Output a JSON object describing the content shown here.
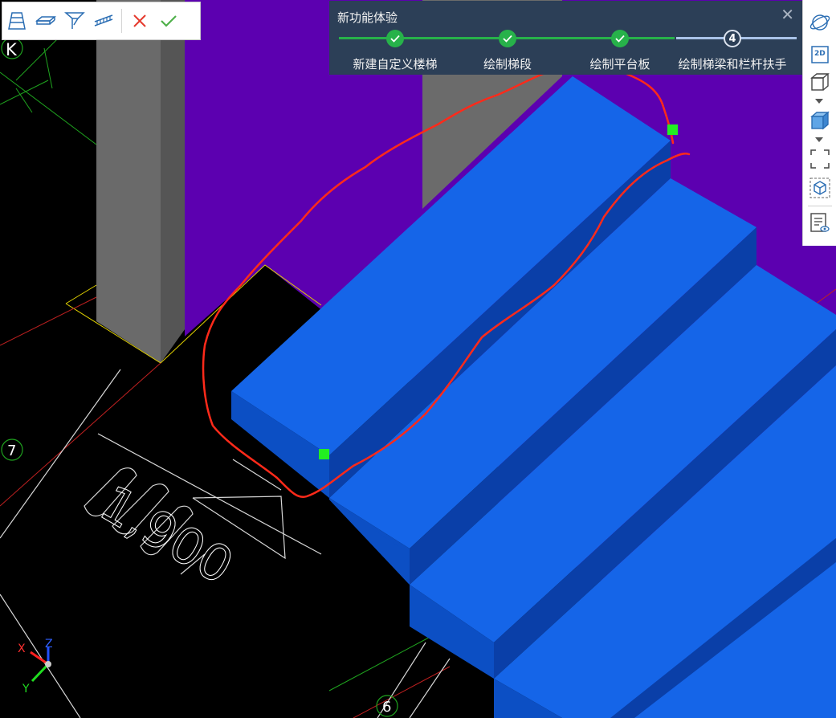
{
  "wizard": {
    "title": "新功能体验",
    "close_label": "✕",
    "steps": [
      {
        "label": "新建自定义楼梯",
        "status": "done"
      },
      {
        "label": "绘制梯段",
        "status": "done"
      },
      {
        "label": "绘制平台板",
        "status": "done"
      },
      {
        "label": "绘制梯梁和栏杆扶手",
        "status": "current",
        "number": "4"
      }
    ]
  },
  "viewport": {
    "axis_labels": {
      "k": "K",
      "seven": "7",
      "six": "6"
    },
    "dimension_text": "1,900",
    "coord_axes": {
      "x": "X",
      "y": "Y",
      "z": "Z"
    }
  },
  "right_toolbar": {
    "view_2d_label": "2D"
  },
  "colors": {
    "stair_top": "#1565e8",
    "stair_front": "#0c4fc4",
    "stair_side": "#0a3fa8",
    "wall_purple": "#5c00b0",
    "column_gray": "#6b6b6b",
    "annotation_red": "#ff2a1a",
    "grip_green": "#22ee22",
    "wizard_bg": "#2c3f57",
    "step_done": "#27b24a"
  },
  "icons": {
    "toolbar": [
      "stair-run-icon",
      "landing-slab-icon",
      "stair-beam-icon",
      "railing-icon",
      "cancel-icon",
      "confirm-icon"
    ],
    "right_toolbar": [
      "orbit-icon",
      "view-2d-icon",
      "view-3d-box-icon",
      "solid-box-icon",
      "fit-view-icon",
      "local-3d-icon",
      "view-properties-icon"
    ]
  }
}
